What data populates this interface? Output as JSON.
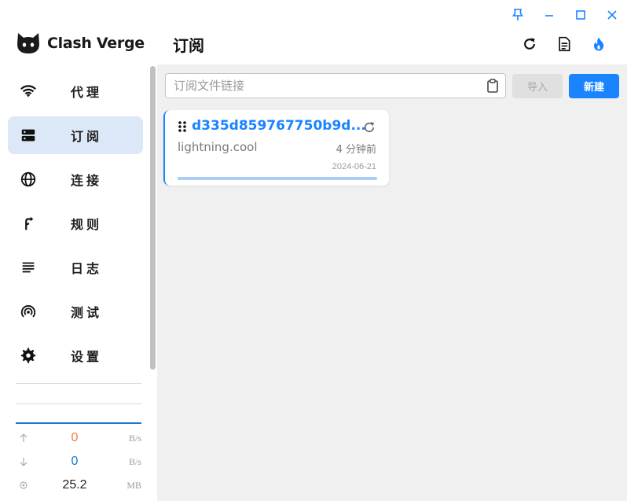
{
  "app": {
    "name": "Clash Verge"
  },
  "nav": {
    "items": [
      {
        "label": "代理",
        "icon": "wifi-icon",
        "active": false
      },
      {
        "label": "订阅",
        "icon": "dns-icon",
        "active": true
      },
      {
        "label": "连接",
        "icon": "globe-icon",
        "active": false
      },
      {
        "label": "规则",
        "icon": "fork-right-icon",
        "active": false
      },
      {
        "label": "日志",
        "icon": "subject-icon",
        "active": false
      },
      {
        "label": "测试",
        "icon": "wifi-tethering-icon",
        "active": false
      },
      {
        "label": "设置",
        "icon": "gear-icon",
        "active": false
      }
    ]
  },
  "traffic": {
    "upload": {
      "value": "0",
      "unit": "B/s",
      "color": "#f47b50"
    },
    "download": {
      "value": "0",
      "unit": "B/s",
      "color": "#1976d2"
    },
    "memory": {
      "value": "25.2",
      "unit": "MB"
    }
  },
  "header": {
    "title": "订阅"
  },
  "url_input": {
    "placeholder": "订阅文件链接",
    "value": ""
  },
  "buttons": {
    "import": "导入",
    "new": "新建"
  },
  "profile": {
    "name": "d335d859767750b9d...",
    "host": "lightning.cool",
    "updated": "4 分钟前",
    "date": "2024-06-21",
    "progress": 1.0
  },
  "colors": {
    "accent": "#1a84ff",
    "active_bg": "#dce8f7"
  }
}
